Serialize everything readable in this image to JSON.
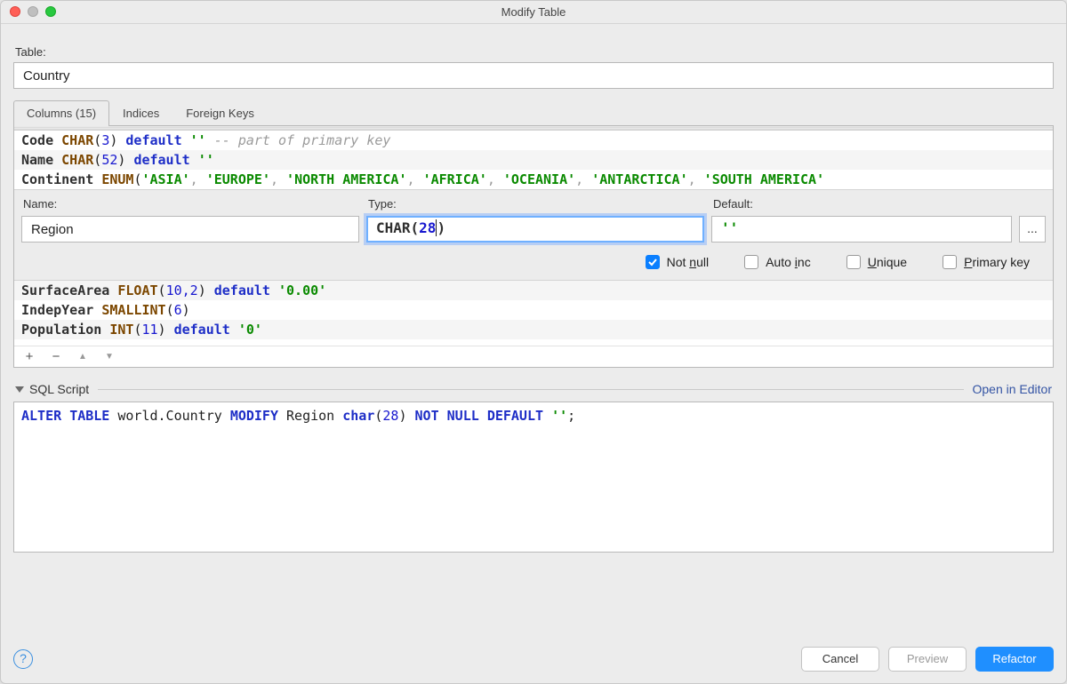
{
  "window": {
    "title": "Modify Table"
  },
  "table": {
    "field_label": "Table:",
    "value": "Country"
  },
  "tabs": [
    {
      "label": "Columns (15)",
      "active": true
    },
    {
      "label": "Indices",
      "active": false
    },
    {
      "label": "Foreign Keys",
      "active": false
    }
  ],
  "columns_list": {
    "rows": [
      {
        "name": "Code",
        "type_kw": "CHAR",
        "type_args": "3",
        "default_kw": "default",
        "default_str": "''",
        "comment": "-- part of primary key"
      },
      {
        "name": "Name",
        "type_kw": "CHAR",
        "type_args": "52",
        "default_kw": "default",
        "default_str": "''"
      },
      {
        "name": "Continent",
        "type_kw": "ENUM",
        "enum_values": [
          "ASIA",
          "EUROPE",
          "NORTH AMERICA",
          "AFRICA",
          "OCEANIA",
          "ANTARCTICA",
          "SOUTH AMERICA"
        ]
      },
      {
        "name": "SurfaceArea",
        "type_kw": "FLOAT",
        "type_args": "10,2",
        "default_kw": "default",
        "default_str": "'0.00'"
      },
      {
        "name": "IndepYear",
        "type_kw": "SMALLINT",
        "type_args": "6"
      },
      {
        "name": "Population",
        "type_kw": "INT",
        "type_args": "11",
        "default_kw": "default",
        "default_str": "'0'"
      }
    ]
  },
  "editor": {
    "labels": {
      "name": "Name:",
      "type": "Type:",
      "default": "Default:"
    },
    "name_value": "Region",
    "type_value": "CHAR(28)",
    "type_value_plain": "CHAR(",
    "type_value_num": "28",
    "type_value_tail": ")",
    "default_value": "''",
    "ellipsis": "...",
    "checks": {
      "not_null": {
        "label_pre": "Not ",
        "label_u": "n",
        "label_post": "ull",
        "checked": true
      },
      "auto_inc": {
        "label_pre": "Auto ",
        "label_u": "i",
        "label_post": "nc",
        "checked": false
      },
      "unique": {
        "label_pre": "",
        "label_u": "U",
        "label_post": "nique",
        "checked": false
      },
      "primary": {
        "label_pre": "",
        "label_u": "P",
        "label_post": "rimary key",
        "checked": false
      }
    }
  },
  "list_toolbar": {
    "add": "+",
    "remove": "−",
    "up": "▲",
    "down": "▼"
  },
  "script": {
    "header": "SQL Script",
    "open_link": "Open in Editor",
    "sql": {
      "kw_alter": "ALTER",
      "kw_table": "TABLE",
      "schema": "world.Country",
      "kw_modify": "MODIFY",
      "col": "Region",
      "kw_type": "char",
      "type_num": "28",
      "kw_notnull": "NOT NULL",
      "kw_default": "DEFAULT",
      "str": "''",
      "semi": ";"
    }
  },
  "footer": {
    "help": "?",
    "cancel": "Cancel",
    "preview": "Preview",
    "refactor": "Refactor"
  }
}
